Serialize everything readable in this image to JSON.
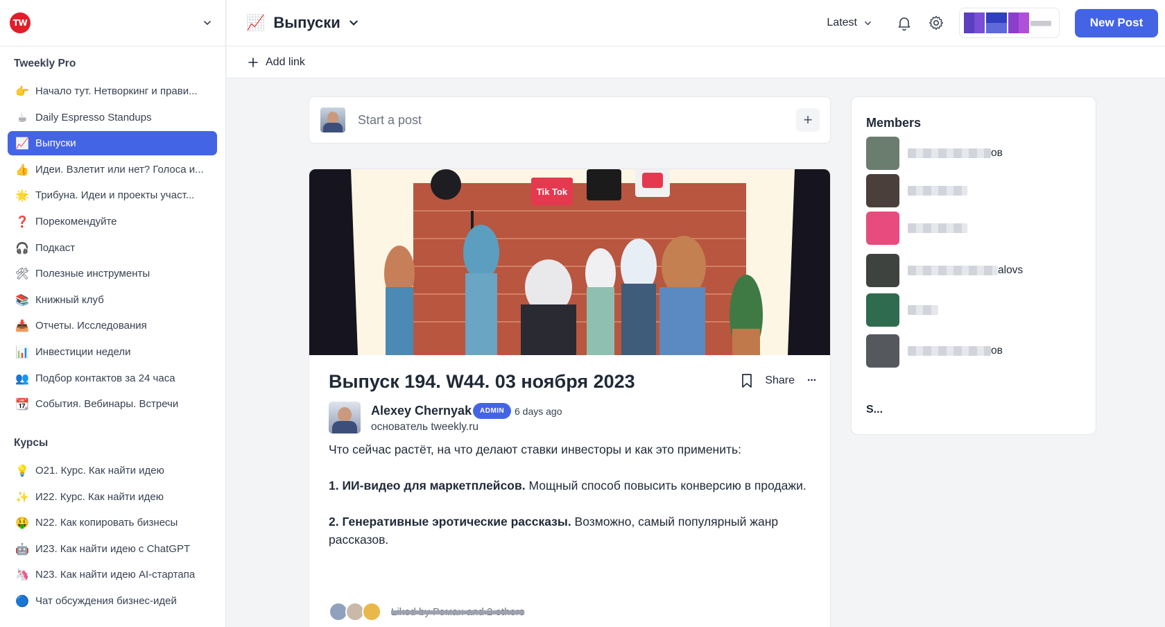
{
  "sidebar": {
    "logo_text": "TW",
    "section1_title": "Tweekly Pro",
    "section1_items": [
      {
        "emoji": "👉",
        "label": "Начало тут. Нетворкинг и прави..."
      },
      {
        "emoji": "☕",
        "label": "Daily Espresso Standups"
      },
      {
        "emoji": "📈",
        "label": "Выпуски"
      },
      {
        "emoji": "👍",
        "label": "Идеи. Взлетит или нет? Голоса и..."
      },
      {
        "emoji": "🌟",
        "label": "Трибуна. Идеи и проекты участ..."
      },
      {
        "emoji": "❓",
        "label": "Порекомендуйте"
      },
      {
        "emoji": "🎧",
        "label": "Подкаст"
      },
      {
        "emoji": "🛠",
        "label": "Полезные инструменты"
      },
      {
        "emoji": "📚",
        "label": "Книжный клуб"
      },
      {
        "emoji": "📥",
        "label": "Отчеты. Исследования"
      },
      {
        "emoji": "📊",
        "label": "Инвестиции недели"
      },
      {
        "emoji": "👥",
        "label": "Подбор контактов за 24 часа"
      },
      {
        "emoji": "📆",
        "label": "События. Вебинары. Встречи"
      }
    ],
    "section2_title": "Курсы",
    "section2_items": [
      {
        "emoji": "💡",
        "label": "O21. Курс. Как найти идею"
      },
      {
        "emoji": "✨",
        "label": "И22. Курс. Как найти идею"
      },
      {
        "emoji": "🤑",
        "label": "N22. Как копировать бизнесы"
      },
      {
        "emoji": "🤖",
        "label": "И23. Как найти идею с ChatGPT"
      },
      {
        "emoji": "🦄",
        "label": "N23. Как найти идею AI-стартапа"
      },
      {
        "emoji": "🔵",
        "label": "Чат обсуждения бизнес-идей"
      }
    ]
  },
  "topbar": {
    "space_icon": "📈",
    "space_title": "Выпуски",
    "sort_label": "Latest",
    "new_post_label": "New Post"
  },
  "subbar": {
    "add_link_label": "Add link"
  },
  "composer": {
    "placeholder": "Start a post",
    "plus": "+"
  },
  "post": {
    "title": "Выпуск 194. W44. 03 ноября 2023",
    "share_label": "Share",
    "more": "···",
    "author_name": "Alexey Chernyak",
    "badge": "ADMIN",
    "time": "6 days ago",
    "author_role": "основатель tweekly.ru",
    "intro": "Что сейчас растёт, на что делают ставки инвесторы и как это применить:",
    "item1_bold": "1. ИИ-видео для маркетплейсов.",
    "item1_text": " Мощный способ повысить конверсию в продажи.",
    "item2_bold": "2. Генеративные эротические рассказы.",
    "item2_text": " Возможно, самый популярный жанр рассказов.",
    "liked_text": "Liked by Роман and 2 others",
    "image_sign": "Tik Tok"
  },
  "members": {
    "title": "Members",
    "list": [
      {
        "name_suffix": "ов",
        "color": "#6b7d6e"
      },
      {
        "name_suffix": "",
        "color": "#4a3f3a"
      },
      {
        "name_suffix": "",
        "color": "#e84c7e"
      },
      {
        "name_suffix": "alovs",
        "color": "#3f4340"
      },
      {
        "name_suffix": "",
        "color": "#2f6b4f"
      },
      {
        "name_suffix": "ов",
        "color": "#55585c"
      }
    ],
    "see_all_label": "S..."
  }
}
